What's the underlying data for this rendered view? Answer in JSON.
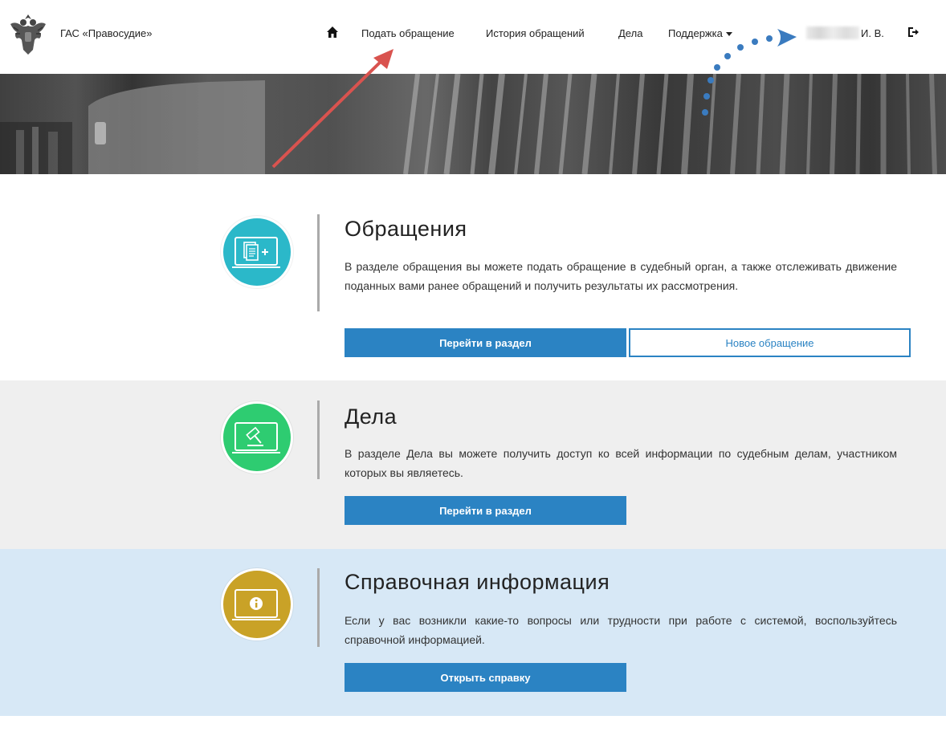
{
  "header": {
    "brand": "ГАС «Правосудие»",
    "nav": {
      "home_icon": "home-icon",
      "submit": "Подать обращение",
      "history": "История обращений",
      "cases": "Дела",
      "support": "Поддержка"
    },
    "user": {
      "initials": "И. В."
    },
    "logout_icon": "logout-icon"
  },
  "sections": [
    {
      "title": "Обращения",
      "icon": "document-add-icon",
      "icon_color": "#2bb8c9",
      "description": "В разделе обращения вы можете подать обращение в судебный орган, а также отслеживать движение поданных вами ранее обращений и получить результаты их рассмотрения.",
      "primary_button": "Перейти в раздел",
      "secondary_button": "Новое обращение"
    },
    {
      "title": "Дела",
      "icon": "gavel-icon",
      "icon_color": "#2ecc71",
      "description": "В разделе Дела вы можете получить доступ ко всей информации по судебным делам, участником которых вы являетесь.",
      "primary_button": "Перейти в раздел"
    },
    {
      "title": "Справочная информация",
      "icon": "info-icon",
      "icon_color": "#c9a227",
      "description": "Если у вас возникли какие-то вопросы или трудности при работе с системой, воспользуйтесь справочной информацией.",
      "primary_button": "Открыть справку"
    }
  ],
  "colors": {
    "accent": "#2b83c3",
    "arrow_red": "#d9534f",
    "arrow_blue": "#3a7bbf"
  }
}
